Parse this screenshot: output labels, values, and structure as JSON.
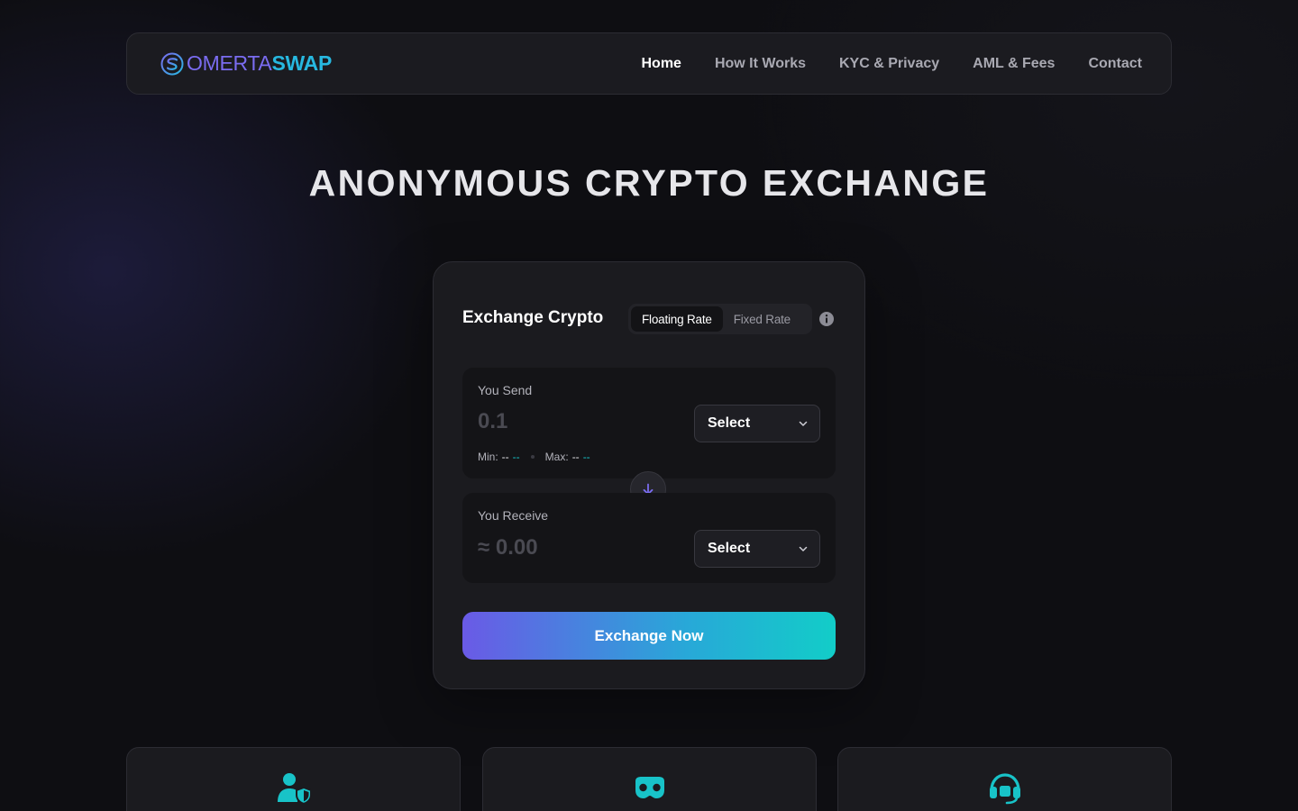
{
  "brand": {
    "name_part1": "OMERTA",
    "name_part2": "SWAP",
    "accent_purple": "#7a6cf0",
    "accent_cyan": "#27b8e0"
  },
  "nav": {
    "items": [
      {
        "label": "Home",
        "active": true
      },
      {
        "label": "How It Works",
        "active": false
      },
      {
        "label": "KYC & Privacy",
        "active": false
      },
      {
        "label": "AML & Fees",
        "active": false
      },
      {
        "label": "Contact",
        "active": false
      }
    ]
  },
  "hero": {
    "title": "ANONYMOUS CRYPTO EXCHANGE"
  },
  "exchange": {
    "title": "Exchange Crypto",
    "rate_options": [
      "Floating Rate",
      "Fixed Rate"
    ],
    "selected_rate": "Floating Rate",
    "info_icon": "info-icon",
    "send": {
      "label": "You Send",
      "placeholder": "0.1",
      "value": "",
      "select_label": "Select",
      "min_label": "Min:",
      "min_value": "--",
      "min_currency": "--",
      "max_label": "Max:",
      "max_value": "--",
      "max_currency": "--"
    },
    "receive": {
      "label": "You Receive",
      "value": "≈ 0.00",
      "select_label": "Select"
    },
    "submit_label": "Exchange Now"
  },
  "features": [
    {
      "icon": "user-shield-icon"
    },
    {
      "icon": "mask-icon"
    },
    {
      "icon": "headset-icon"
    }
  ]
}
